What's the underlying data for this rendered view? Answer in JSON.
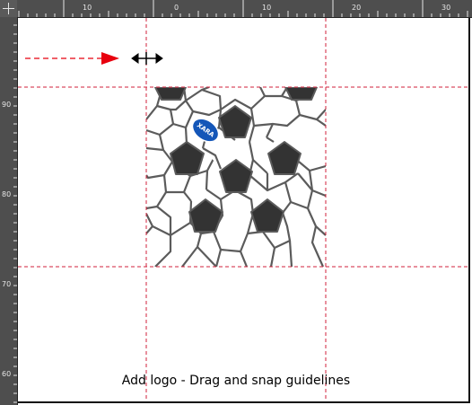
{
  "ruler": {
    "top_labels": [
      "10",
      "0",
      "10",
      "20",
      "30"
    ],
    "left_labels": [
      "90",
      "80",
      "70",
      "60"
    ]
  },
  "canvas": {
    "logo_text": "XARA",
    "caption": "Add logo - Drag and snap guidelines"
  },
  "colors": {
    "ruler_bg": "#4e4e4e",
    "ruler_mark": "#e6e6e6",
    "guideline": "#d0223b",
    "arrow": "#e8000e",
    "pentagon": "#333333",
    "hexagon_stroke": "#5b5b5b",
    "logo_blue": "#1456b8"
  },
  "icons": {
    "drag_arrow": "red-dashed-arrow-icon",
    "resize_cursor": "horizontal-resize-cursor-icon"
  }
}
